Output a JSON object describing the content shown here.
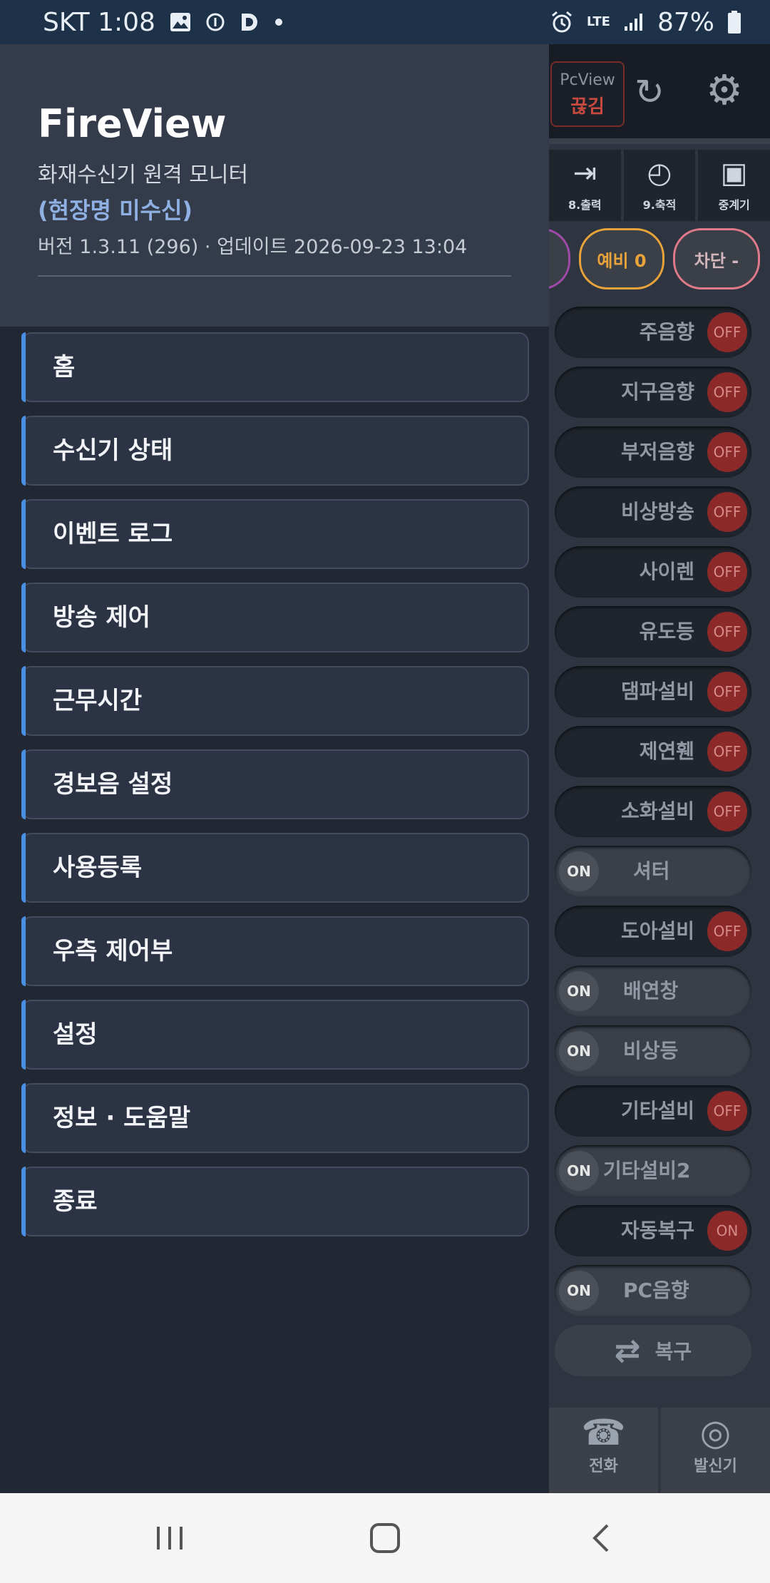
{
  "status_bar": {
    "carrier_time": "SKT 1:08",
    "network": "LTE",
    "battery": "87%"
  },
  "background_app": {
    "pcview_label": "PcView",
    "pcview_status": "끊김",
    "tabs": [
      {
        "label": "8.출력",
        "icon": "exit-icon"
      },
      {
        "label": "9.축적",
        "icon": "clock-icon"
      },
      {
        "label": "중계기",
        "icon": "box-icon"
      }
    ],
    "chips": [
      {
        "label": "예비 0",
        "color": "#e8a33a"
      },
      {
        "label": "차단 -",
        "color": "#e07a8a"
      }
    ],
    "toggles": [
      {
        "label": "주음향",
        "state": "OFF"
      },
      {
        "label": "지구음향",
        "state": "OFF"
      },
      {
        "label": "부저음향",
        "state": "OFF"
      },
      {
        "label": "비상방송",
        "state": "OFF"
      },
      {
        "label": "사이렌",
        "state": "OFF"
      },
      {
        "label": "유도등",
        "state": "OFF"
      },
      {
        "label": "댐파설비",
        "state": "OFF"
      },
      {
        "label": "제연휀",
        "state": "OFF"
      },
      {
        "label": "소화설비",
        "state": "OFF"
      },
      {
        "label": "셔터",
        "state": "ON"
      },
      {
        "label": "도아설비",
        "state": "OFF"
      },
      {
        "label": "배연창",
        "state": "ON"
      },
      {
        "label": "비상등",
        "state": "ON"
      },
      {
        "label": "기타설비",
        "state": "OFF"
      },
      {
        "label": "기타설비2",
        "state": "ON"
      },
      {
        "label": "자동복구",
        "state": "ON_RED"
      },
      {
        "label": "PC음향",
        "state": "ON"
      }
    ],
    "restore_label": "복구",
    "bottom_buttons": [
      {
        "label": "전화",
        "icon": "telephone-icon"
      },
      {
        "label": "발신기",
        "icon": "bell-icon"
      }
    ]
  },
  "drawer": {
    "title": "FireView",
    "subtitle": "화재수신기 원격 모니터",
    "site_name": "(현장명 미수신)",
    "version": "버전 1.3.11 (296)  ·  업데이트 2026-09-23 13:04",
    "menu": [
      {
        "label": "홈"
      },
      {
        "label": "수신기 상태"
      },
      {
        "label": "이벤트 로그"
      },
      {
        "label": "방송 제어"
      },
      {
        "label": "근무시간"
      },
      {
        "label": "경보음 설정"
      },
      {
        "label": "사용등록"
      },
      {
        "label": "우측 제어부"
      },
      {
        "label": "설정"
      },
      {
        "label": "정보 · 도움말"
      },
      {
        "label": "종료"
      }
    ]
  },
  "colors": {
    "accent": "#4a90e2",
    "off_red": "#8c2a2a",
    "site_name": "#8fb0e2"
  }
}
